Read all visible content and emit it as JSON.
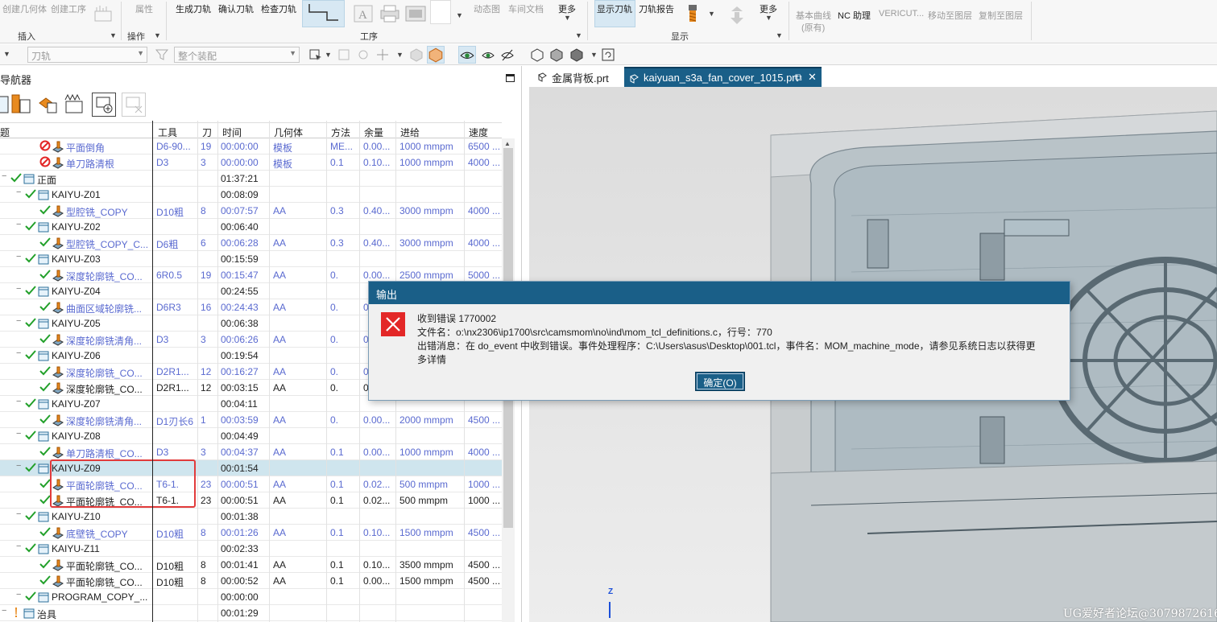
{
  "ribbon": {
    "buttons": [
      {
        "label": "创建几何体",
        "disabled": true
      },
      {
        "label": "创建工序",
        "disabled": true
      },
      {
        "label": "属性",
        "disabled": true
      },
      {
        "label": "生成刀轨",
        "disabled": false
      },
      {
        "label": "确认刀轨",
        "disabled": false
      },
      {
        "label": "检查刀轨",
        "disabled": false
      },
      {
        "label": "动态图",
        "disabled": true
      },
      {
        "label": "车间文档",
        "disabled": true
      },
      {
        "label": "更多",
        "disabled": false
      },
      {
        "label": "显示刀轨",
        "disabled": false
      },
      {
        "label": "刀轨报告",
        "disabled": false
      },
      {
        "label": "更多",
        "disabled": false
      },
      {
        "label": "基本曲线",
        "disabled": true
      },
      {
        "label": "(原有)",
        "disabled": true
      },
      {
        "label": "NC 助理",
        "disabled": false
      },
      {
        "label": "VERICUT...",
        "disabled": true
      },
      {
        "label": "移动至图层",
        "disabled": true
      },
      {
        "label": "复制至图层",
        "disabled": true
      }
    ],
    "groups": [
      "插入",
      "操作",
      "工序",
      "显示"
    ]
  },
  "toolbar2": {
    "combo1": "刀轨",
    "combo2": "整个装配"
  },
  "navigator": {
    "title": "导航器",
    "columns": [
      "题",
      "工具",
      "刀",
      "时间",
      "几何体",
      "方法",
      "余量",
      "进给",
      "速度"
    ],
    "rows": [
      {
        "name": "平面倒角",
        "tool": "D6-90...",
        "knife": "19",
        "time": "00:00:00",
        "geo": "模板",
        "method": "ME...",
        "rem": "0.00...",
        "feed": "1000 mmpm",
        "speed": "6500 ...",
        "kind": "op-err",
        "blue": true,
        "indent": 3
      },
      {
        "name": "单刀路清根",
        "tool": "D3",
        "knife": "3",
        "time": "00:00:00",
        "geo": "模板",
        "method": "0.1",
        "rem": "0.10...",
        "feed": "1000 mmpm",
        "speed": "4000 ...",
        "kind": "op-err",
        "blue": true,
        "indent": 3
      },
      {
        "name": "正面",
        "tool": "",
        "knife": "",
        "time": "01:37:21",
        "geo": "",
        "method": "",
        "rem": "",
        "feed": "",
        "speed": "",
        "kind": "group",
        "blue": false,
        "indent": 1
      },
      {
        "name": "KAIYU-Z01",
        "tool": "",
        "knife": "",
        "time": "00:08:09",
        "geo": "",
        "method": "",
        "rem": "",
        "feed": "",
        "speed": "",
        "kind": "group",
        "blue": false,
        "indent": 2
      },
      {
        "name": "型腔铣_COPY",
        "tool": "D10粗",
        "knife": "8",
        "time": "00:07:57",
        "geo": "AA",
        "method": "0.3",
        "rem": "0.40...",
        "feed": "3000 mmpm",
        "speed": "4000 ...",
        "kind": "op",
        "blue": true,
        "indent": 3
      },
      {
        "name": "KAIYU-Z02",
        "tool": "",
        "knife": "",
        "time": "00:06:40",
        "geo": "",
        "method": "",
        "rem": "",
        "feed": "",
        "speed": "",
        "kind": "group",
        "blue": false,
        "indent": 2
      },
      {
        "name": "型腔铣_COPY_C...",
        "tool": "D6粗",
        "knife": "6",
        "time": "00:06:28",
        "geo": "AA",
        "method": "0.3",
        "rem": "0.40...",
        "feed": "3000 mmpm",
        "speed": "4000 ...",
        "kind": "op",
        "blue": true,
        "indent": 3
      },
      {
        "name": "KAIYU-Z03",
        "tool": "",
        "knife": "",
        "time": "00:15:59",
        "geo": "",
        "method": "",
        "rem": "",
        "feed": "",
        "speed": "",
        "kind": "group",
        "blue": false,
        "indent": 2
      },
      {
        "name": "深度轮廓铣_CO...",
        "tool": "6R0.5",
        "knife": "19",
        "time": "00:15:47",
        "geo": "AA",
        "method": "0.",
        "rem": "0.00...",
        "feed": "2500 mmpm",
        "speed": "5000 ...",
        "kind": "op",
        "blue": true,
        "indent": 3
      },
      {
        "name": "KAIYU-Z04",
        "tool": "",
        "knife": "",
        "time": "00:24:55",
        "geo": "",
        "method": "",
        "rem": "",
        "feed": "",
        "speed": "",
        "kind": "group",
        "blue": false,
        "indent": 2
      },
      {
        "name": "曲面区域轮廓铣...",
        "tool": "D6R3",
        "knife": "16",
        "time": "00:24:43",
        "geo": "AA",
        "method": "0.",
        "rem": "0.",
        "feed": "",
        "speed": "",
        "kind": "op",
        "blue": true,
        "indent": 3
      },
      {
        "name": "KAIYU-Z05",
        "tool": "",
        "knife": "",
        "time": "00:06:38",
        "geo": "",
        "method": "",
        "rem": "",
        "feed": "",
        "speed": "",
        "kind": "group",
        "blue": false,
        "indent": 2
      },
      {
        "name": "深度轮廓铣清角...",
        "tool": "D3",
        "knife": "3",
        "time": "00:06:26",
        "geo": "AA",
        "method": "0.",
        "rem": "0",
        "feed": "",
        "speed": "",
        "kind": "op",
        "blue": true,
        "indent": 3
      },
      {
        "name": "KAIYU-Z06",
        "tool": "",
        "knife": "",
        "time": "00:19:54",
        "geo": "",
        "method": "",
        "rem": "",
        "feed": "",
        "speed": "",
        "kind": "group",
        "blue": false,
        "indent": 2
      },
      {
        "name": "深度轮廓铣_CO...",
        "tool": "D2R1...",
        "knife": "12",
        "time": "00:16:27",
        "geo": "AA",
        "method": "0.",
        "rem": "0",
        "feed": "",
        "speed": "",
        "kind": "op",
        "blue": true,
        "indent": 3
      },
      {
        "name": "深度轮廓铣_CO...",
        "tool": "D2R1...",
        "knife": "12",
        "time": "00:03:15",
        "geo": "AA",
        "method": "0.",
        "rem": "0",
        "feed": "",
        "speed": "",
        "kind": "op",
        "blue": false,
        "indent": 3
      },
      {
        "name": "KAIYU-Z07",
        "tool": "",
        "knife": "",
        "time": "00:04:11",
        "geo": "",
        "method": "",
        "rem": "",
        "feed": "",
        "speed": "",
        "kind": "group",
        "blue": false,
        "indent": 2
      },
      {
        "name": "深度轮廓铣清角...",
        "tool": "D1刃长6",
        "knife": "1",
        "time": "00:03:59",
        "geo": "AA",
        "method": "0.",
        "rem": "0.00...",
        "feed": "2000 mmpm",
        "speed": "4500 ...",
        "kind": "op",
        "blue": true,
        "indent": 3
      },
      {
        "name": "KAIYU-Z08",
        "tool": "",
        "knife": "",
        "time": "00:04:49",
        "geo": "",
        "method": "",
        "rem": "",
        "feed": "",
        "speed": "",
        "kind": "group",
        "blue": false,
        "indent": 2
      },
      {
        "name": "单刀路清根_CO...",
        "tool": "D3",
        "knife": "3",
        "time": "00:04:37",
        "geo": "AA",
        "method": "0.1",
        "rem": "0.00...",
        "feed": "1000 mmpm",
        "speed": "4000 ...",
        "kind": "op",
        "blue": true,
        "indent": 3
      },
      {
        "name": "KAIYU-Z09",
        "tool": "",
        "knife": "",
        "time": "00:01:54",
        "geo": "",
        "method": "",
        "rem": "",
        "feed": "",
        "speed": "",
        "kind": "group",
        "blue": false,
        "indent": 2,
        "selected": true
      },
      {
        "name": "平面轮廓铣_CO...",
        "tool": "T6-1.",
        "knife": "23",
        "time": "00:00:51",
        "geo": "AA",
        "method": "0.1",
        "rem": "0.02...",
        "feed": "500 mmpm",
        "speed": "1000 ...",
        "kind": "op",
        "blue": true,
        "indent": 3
      },
      {
        "name": "平面轮廓铣_CO...",
        "tool": "T6-1.",
        "knife": "23",
        "time": "00:00:51",
        "geo": "AA",
        "method": "0.1",
        "rem": "0.02...",
        "feed": "500 mmpm",
        "speed": "1000 ...",
        "kind": "op",
        "blue": false,
        "indent": 3
      },
      {
        "name": "KAIYU-Z10",
        "tool": "",
        "knife": "",
        "time": "00:01:38",
        "geo": "",
        "method": "",
        "rem": "",
        "feed": "",
        "speed": "",
        "kind": "group",
        "blue": false,
        "indent": 2
      },
      {
        "name": "底壁铣_COPY",
        "tool": "D10粗",
        "knife": "8",
        "time": "00:01:26",
        "geo": "AA",
        "method": "0.1",
        "rem": "0.10...",
        "feed": "1500 mmpm",
        "speed": "4500 ...",
        "kind": "op",
        "blue": true,
        "indent": 3
      },
      {
        "name": "KAIYU-Z11",
        "tool": "",
        "knife": "",
        "time": "00:02:33",
        "geo": "",
        "method": "",
        "rem": "",
        "feed": "",
        "speed": "",
        "kind": "group",
        "blue": false,
        "indent": 2
      },
      {
        "name": "平面轮廓铣_CO...",
        "tool": "D10粗",
        "knife": "8",
        "time": "00:01:41",
        "geo": "AA",
        "method": "0.1",
        "rem": "0.10...",
        "feed": "3500 mmpm",
        "speed": "4500 ...",
        "kind": "op",
        "blue": false,
        "indent": 3
      },
      {
        "name": "平面轮廓铣_CO...",
        "tool": "D10粗",
        "knife": "8",
        "time": "00:00:52",
        "geo": "AA",
        "method": "0.1",
        "rem": "0.00...",
        "feed": "1500 mmpm",
        "speed": "4500 ...",
        "kind": "op",
        "blue": false,
        "indent": 3
      },
      {
        "name": "PROGRAM_COPY_...",
        "tool": "",
        "knife": "",
        "time": "00:00:00",
        "geo": "",
        "method": "",
        "rem": "",
        "feed": "",
        "speed": "",
        "kind": "group",
        "blue": false,
        "indent": 2
      },
      {
        "name": "治具",
        "tool": "",
        "knife": "",
        "time": "00:01:29",
        "geo": "",
        "method": "",
        "rem": "",
        "feed": "",
        "speed": "",
        "kind": "group-warn",
        "blue": false,
        "indent": 1
      }
    ]
  },
  "tabs": [
    {
      "label": "金属背板.prt",
      "active": false
    },
    {
      "label": "kaiyuan_s3a_fan_cover_1015.prt",
      "active": true
    }
  ],
  "viewport": {
    "axis_label": "Z"
  },
  "dialog": {
    "title": "输出",
    "line1": "收到错误 1770002",
    "line2": "文件名：o:\\nx2306\\ip1700\\src\\camsmom\\no\\ind\\mom_tcl_definitions.c，行号：770",
    "line3": "出错消息：在 do_event 中收到错误。事件处理程序：C:\\Users\\asus\\Desktop\\001.tcl，事件名：MOM_machine_mode，请参见系统日志以获得更",
    "line4": "多详情",
    "ok_label": "确定(O)"
  },
  "watermark": "UG爱好者论坛@3079872616",
  "colors": {
    "accent": "#1a5f88",
    "check": "#22a02a",
    "error": "#e32727",
    "blue_text": "#5a6ad0",
    "highlight_box": "#e23b3b"
  }
}
